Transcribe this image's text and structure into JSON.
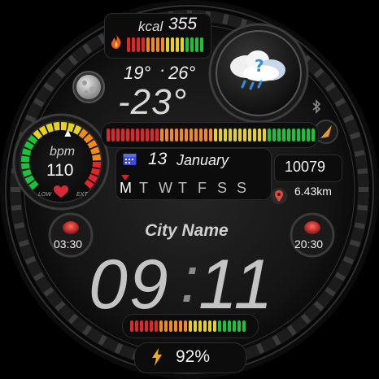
{
  "calories": {
    "unit": "kcal",
    "value": "355",
    "icon": "flame-icon"
  },
  "weather": {
    "temp_low": "19°",
    "temp_high": "26°",
    "current_temp": "-23°",
    "icon": "cloud-rain-icon"
  },
  "moon": {
    "icon": "moon-icon"
  },
  "bluetooth": {
    "icon": "bluetooth-icon"
  },
  "heart_rate": {
    "unit": "bpm",
    "value": "110",
    "low_label": "LOW",
    "high_label": "EXT",
    "level": 0.55
  },
  "date": {
    "day": "13",
    "month": "January",
    "icon": "calendar-icon"
  },
  "weekdays": {
    "letters": [
      "M",
      "T",
      "W",
      "T",
      "F",
      "S",
      "S"
    ],
    "current_index": 0
  },
  "steps": {
    "value": "10079",
    "distance": "6.43km",
    "icon": "location-pin-icon"
  },
  "sunrise": {
    "time": "03:30",
    "icon": "sunrise-icon"
  },
  "sunset": {
    "time": "20:30",
    "icon": "sunset-icon"
  },
  "city": {
    "name": "City Name"
  },
  "time": {
    "hours": "09",
    "separator": ":",
    "minutes": "11"
  },
  "battery": {
    "value": "92%",
    "icon": "lightning-icon",
    "level": 0.92
  },
  "colors": {
    "green": "#19c33a",
    "yellow": "#e6d21a",
    "orange": "#f28a1a",
    "red": "#e0262a",
    "accent_red": "#d32030"
  }
}
